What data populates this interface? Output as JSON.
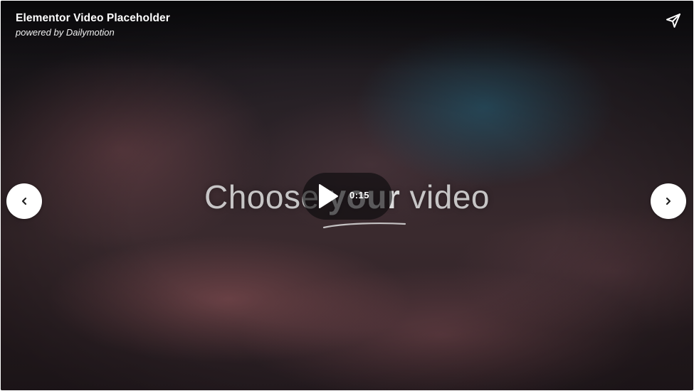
{
  "player": {
    "title": "Elementor Video Placeholder",
    "powered_by": "powered by Dailymotion",
    "duration": "0:15",
    "headline_start": "Choose",
    "headline_mid": "your",
    "headline_end": "video"
  },
  "icons": {
    "share": "send-arrow-icon",
    "play": "play-icon",
    "prev": "chevron-left-icon",
    "next": "chevron-right-icon"
  },
  "colors": {
    "overlay_text": "#ffffff",
    "nav_button_bg": "#ffffff",
    "play_button_bg": "rgba(10,10,12,0.62)"
  }
}
